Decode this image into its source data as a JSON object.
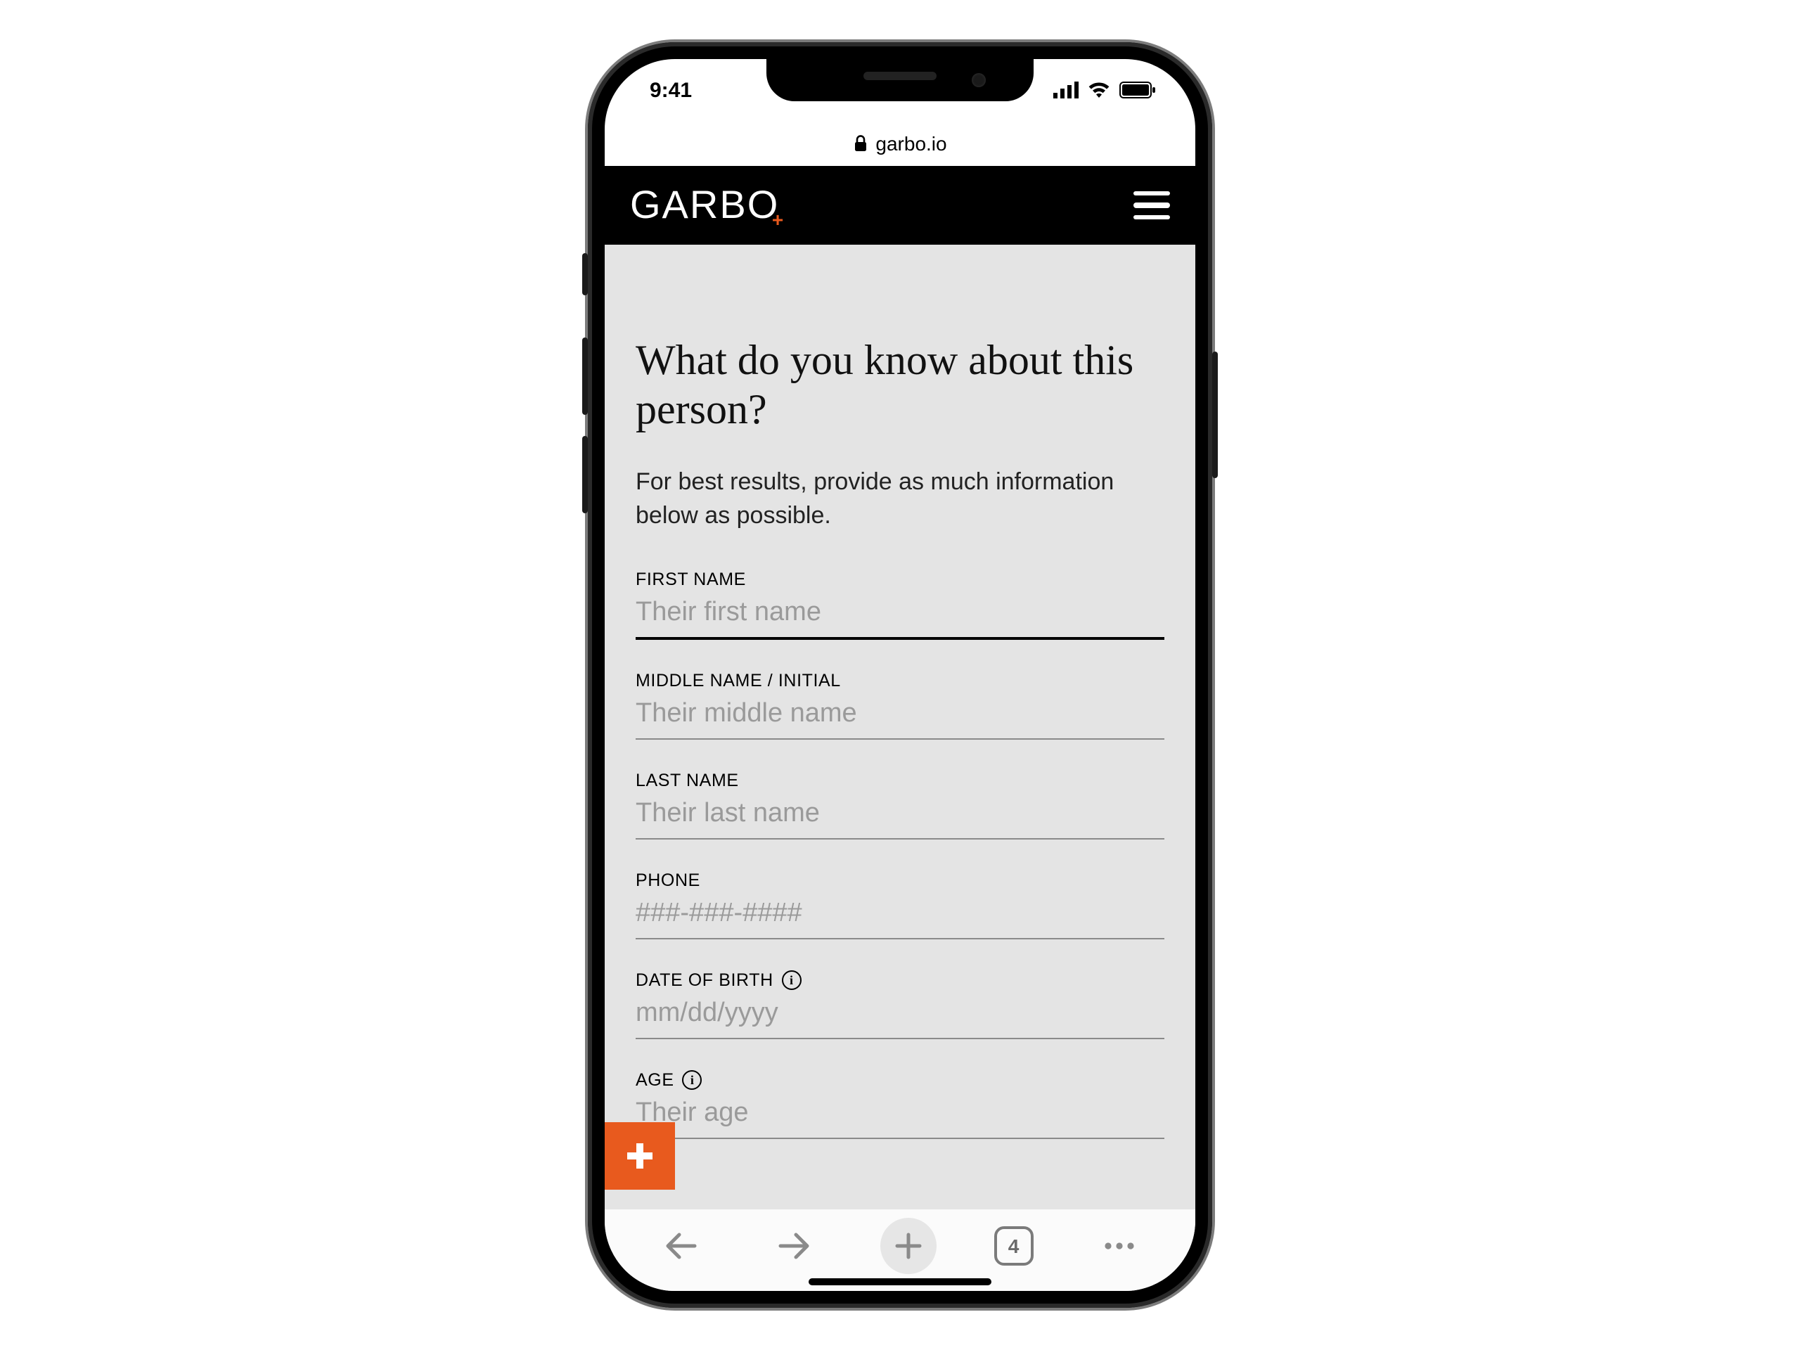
{
  "status": {
    "time": "9:41"
  },
  "browser": {
    "domain": "garbo.io",
    "tab_count": "4"
  },
  "header": {
    "logo_text": "GARBO"
  },
  "page": {
    "heading": "What do you know about this person?",
    "subheading": "For best results, provide as much information below as possible."
  },
  "form": {
    "first_name": {
      "label": "FIRST NAME",
      "placeholder": "Their first name"
    },
    "middle_name": {
      "label": "MIDDLE NAME / INITIAL",
      "placeholder": "Their middle name"
    },
    "last_name": {
      "label": "LAST NAME",
      "placeholder": "Their last name"
    },
    "phone": {
      "label": "PHONE",
      "placeholder": "###-###-####"
    },
    "dob": {
      "label": "DATE OF BIRTH",
      "placeholder": "mm/dd/yyyy"
    },
    "age": {
      "label": "AGE",
      "placeholder": "Their age"
    }
  }
}
